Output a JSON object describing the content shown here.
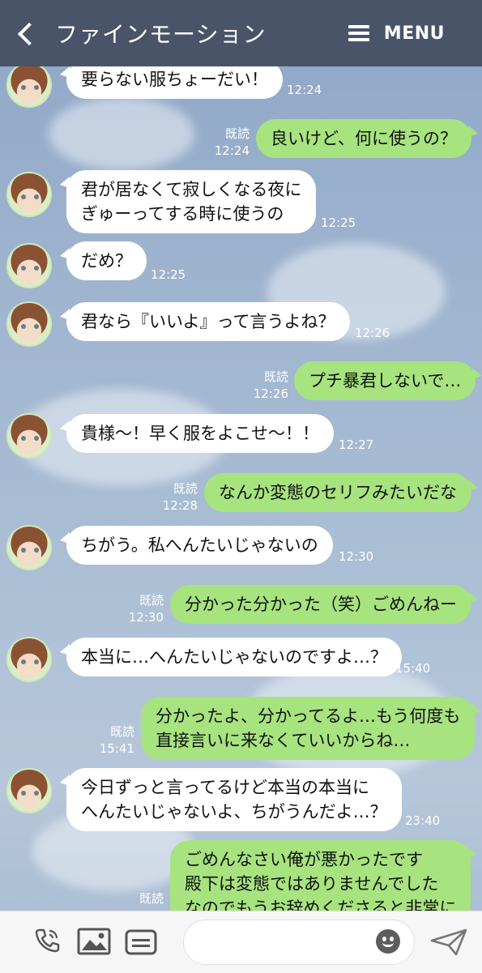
{
  "header": {
    "title": "ファインモーション",
    "menu_label": "MENU"
  },
  "read_label": "既読",
  "messages": [
    {
      "side": "left",
      "text": "要らない服ちょーだい！",
      "time": "12:24"
    },
    {
      "side": "right",
      "text": "良いけど、何に使うの？",
      "time": "12:24",
      "read": true
    },
    {
      "side": "left",
      "text": "君が居なくて寂しくなる夜に\nぎゅーってする時に使うの",
      "time": "12:25"
    },
    {
      "side": "left",
      "text": "だめ？",
      "time": "12:25"
    },
    {
      "side": "left",
      "text": "君なら『いいよ』って言うよね？",
      "time": "12:26"
    },
    {
      "side": "right",
      "text": "プチ暴君しないで…",
      "time": "12:26",
      "read": true
    },
    {
      "side": "left",
      "text": "貴様〜！早く服をよこせ〜！！",
      "time": "12:27"
    },
    {
      "side": "right",
      "text": "なんか変態のセリフみたいだな",
      "time": "12:28",
      "read": true
    },
    {
      "side": "left",
      "text": "ちがう。私へんたいじゃないの",
      "time": "12:30"
    },
    {
      "side": "right",
      "text": "分かった分かった（笑）ごめんねー",
      "time": "12:30",
      "read": true
    },
    {
      "side": "left",
      "text": "本当に…へんたいじゃないのですよ…？",
      "time": "15:40"
    },
    {
      "side": "right",
      "text": "分かったよ、分かってるよ…もう何度も\n直接言いに来なくていいからね…",
      "time": "15:41",
      "read": true
    },
    {
      "side": "left",
      "text": "今日ずっと言ってるけど本当の本当に\nへんたいじゃないよ、ちがうんだよ…？",
      "time": "23:40"
    },
    {
      "side": "right",
      "text": "ごめんなさい俺が悪かったです\n殿下は変態ではありませんでした\nなのでもうお辞めくださると非常に",
      "time": "",
      "read": true
    }
  ],
  "input": {
    "placeholder": ""
  },
  "icons": [
    "chevron-left-icon",
    "menu-icon",
    "phone-icon",
    "image-icon",
    "keyboard-icon",
    "emoji-icon",
    "send-icon"
  ],
  "colors": {
    "header": "#4a5468",
    "sent_bubble": "#a7e37f",
    "received_bubble": "#ffffff"
  }
}
